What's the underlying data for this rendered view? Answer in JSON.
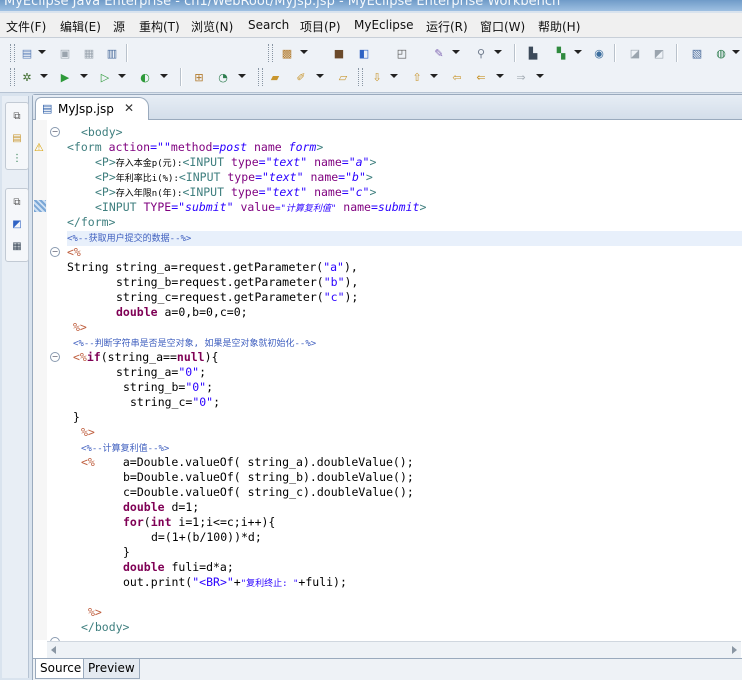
{
  "window": {
    "title": "MyEclipse Java Enterprise - ch1/WebRoot/MyJsp.jsp - MyEclipse Enterprise Workbench"
  },
  "menu": [
    "文件(F)",
    "编辑(E)",
    "源",
    "重构(T)",
    "浏览(N)",
    "Search",
    "项目(P)",
    "MyEclipse",
    "运行(R)",
    "窗口(W)",
    "帮助(H)"
  ],
  "editor": {
    "tab_label": "MyJsp.jsp",
    "close_glyph": "✕",
    "code": {
      "l1": "<body>",
      "l2_form": "<form",
      "l2_action": "action",
      "l2_eq1": "=\"\"",
      "l2_method": "method",
      "l2_post": "=post",
      "l2_name": "name",
      "l2_formval": "form",
      "l2_close": ">",
      "l3_p": "<P>",
      "l3_label": "存入本金p(元):",
      "l3_input": "<INPUT",
      "l3_type": "type",
      "l3_text": "=\"text\"",
      "l3_name": "name",
      "l3_val": "=\"a\"",
      "l3_end": ">",
      "l4_label": "年利率比i(%):",
      "l4_val": "=\"b\"",
      "l5_label": "存入年限n(年):",
      "l5_val": "=\"c\"",
      "l6_input": "<INPUT",
      "l6_type": "TYPE",
      "l6_submit": "=\"submit\"",
      "l6_value": "value",
      "l6_calc": "=\"计算复利值\"",
      "l6_name": "name",
      "l6_submitval": "=submit",
      "l6_end": ">",
      "l7": "</form>",
      "l8": "<%--获取用户提交的数据--%>",
      "l9": "<%",
      "l10_type": "String",
      "l10_rest": " string_a=request.getParameter(",
      "l10_s": "\"a\"",
      "l10_end": "),",
      "l11_rest": "string_b=request.getParameter(",
      "l11_s": "\"b\"",
      "l11_end": "),",
      "l12_rest": "string_c=request.getParameter(",
      "l12_s": "\"c\"",
      "l12_end": ");",
      "l13_kw": "double",
      "l13_rest": " a=0,b=0,c=0;",
      "l14": "%>",
      "l15": "<%--判断字符串是否是空对象, 如果是空对象就初始化--%>",
      "l16_open": "<%",
      "l16_if": "if",
      "l16_mid": "(string_a==",
      "l16_null": "null",
      "l16_end": "){",
      "l17_rest": "string_a=",
      "l17_s": "\"0\"",
      "l17_end": ";",
      "l18_rest": "string_b=",
      "l18_s": "\"0\"",
      "l18_end": ";",
      "l19_rest": "string_c=",
      "l19_s": "\"0\"",
      "l19_end": ";",
      "l20": "}",
      "l21": "%>",
      "l22": "<%--计算复利值--%>",
      "l23_open": "<%",
      "l23_rest": "a=Double.valueOf( string_a).doubleValue();",
      "l24": "b=Double.valueOf( string_b).doubleValue();",
      "l25": "c=Double.valueOf( string_c).doubleValue();",
      "l26_kw": "double",
      "l26_rest": " d=1;",
      "l27_kw1": "for",
      "l27_a": "(",
      "l27_kw2": "int",
      "l27_rest": " i=1;i<=c;i++){",
      "l28": "d=(1+(b/100))*d;",
      "l29": "}",
      "l30_kw": "double",
      "l30_rest": " fuli=d*a;",
      "l31_a": "out.print(",
      "l31_s1": "\"<BR>\"",
      "l31_plus": "+",
      "l31_s2": "\"复利终止: \"",
      "l31_end": "+fuli);",
      "l32": "%>",
      "l33": "</body>"
    }
  },
  "bottom_tabs": [
    "Source",
    "Preview"
  ],
  "icons": [
    "new-file-icon",
    "save-icon",
    "save-all-icon",
    "print-icon",
    "new-project-icon",
    "package-icon",
    "class-icon",
    "console-icon",
    "refactor-icon",
    "search-icon",
    "deploy-icon",
    "server-icon",
    "globe-icon",
    "open-perspective-icon",
    "preferences-icon",
    "web-icon",
    "debug-icon",
    "run-icon",
    "run-external-icon",
    "run-config-icon",
    "open-type-icon",
    "open-resource-icon",
    "open-folder-icon",
    "task-icon",
    "next-annotation-icon",
    "prev-annotation-icon",
    "last-edit-icon",
    "back-icon",
    "forward-icon"
  ]
}
